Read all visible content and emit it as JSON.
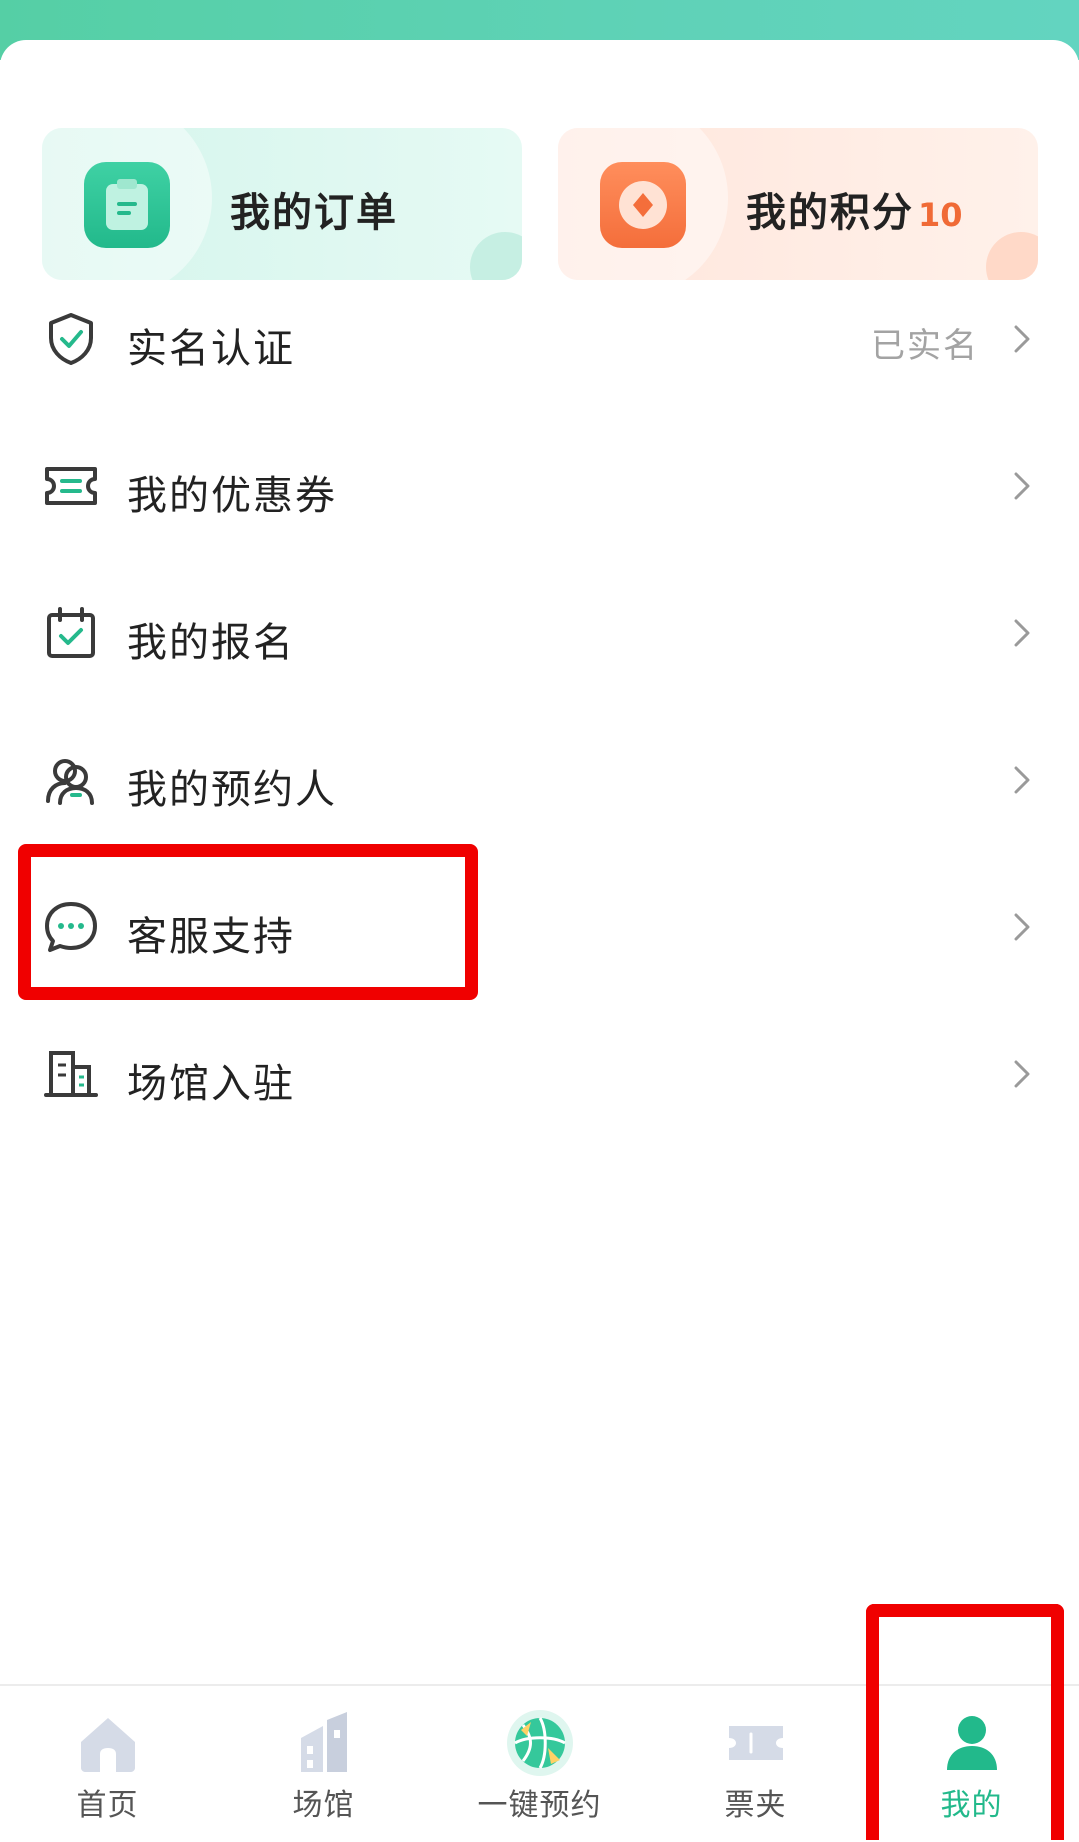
{
  "colors": {
    "accent": "#22b98b",
    "points_accent": "#f06a36",
    "highlight": "#f00000",
    "muted_text": "#a3a3a3"
  },
  "quick_cards": {
    "orders": {
      "label": "我的订单",
      "icon": "clipboard-icon"
    },
    "points": {
      "label": "我的积分",
      "count": "10",
      "icon": "coin-icon"
    }
  },
  "menu": [
    {
      "label": "实名认证",
      "status": "已实名",
      "icon": "shield-check-icon"
    },
    {
      "label": "我的优惠券",
      "icon": "coupon-icon"
    },
    {
      "label": "我的报名",
      "icon": "calendar-check-icon"
    },
    {
      "label": "我的预约人",
      "icon": "people-icon"
    },
    {
      "label": "客服支持",
      "icon": "chat-bubble-icon"
    },
    {
      "label": "场馆入驻",
      "icon": "building-icon"
    }
  ],
  "tabbar": {
    "items": [
      {
        "label": "首页",
        "icon": "home-icon"
      },
      {
        "label": "场馆",
        "icon": "venue-icon"
      },
      {
        "label": "一键预约",
        "icon": "basketball-icon"
      },
      {
        "label": "票夹",
        "icon": "ticket-icon"
      },
      {
        "label": "我的",
        "icon": "user-icon"
      }
    ],
    "active": "我的"
  }
}
